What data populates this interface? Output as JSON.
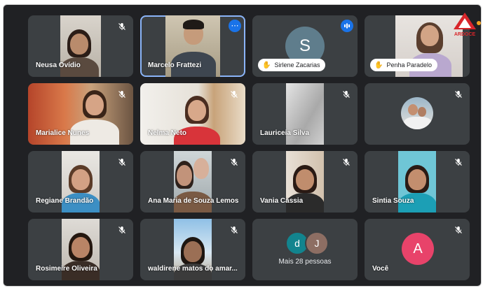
{
  "participants": [
    {
      "name": "Neusa Ovídio"
    },
    {
      "name": "Marcelo Frattezi"
    },
    {
      "name": "Sirlene Zacarias",
      "initial": "S"
    },
    {
      "name": "Penha Paradelo"
    },
    {
      "name": "Marialice Nunes"
    },
    {
      "name": "Nelma Neto"
    },
    {
      "name": "Lauriceia Silva"
    },
    {
      "name": ""
    },
    {
      "name": "Regiane Brandão"
    },
    {
      "name": "Ana Maria de Souza Lemos"
    },
    {
      "name": "Vania Cassia"
    },
    {
      "name": "Sintia Souza"
    },
    {
      "name": "Rosimeire Oliveira"
    },
    {
      "name": "waldirene matos do amar..."
    }
  ],
  "more": {
    "label": "Mais 28 pessoas",
    "initials": [
      "d",
      "J"
    ]
  },
  "self": {
    "label": "Você",
    "initial": "A"
  },
  "logo": {
    "text": "ARDOCE"
  },
  "colors": {
    "tile": "#3c4043",
    "accent": "#1a73e8",
    "self_avatar": "#e8436a"
  }
}
